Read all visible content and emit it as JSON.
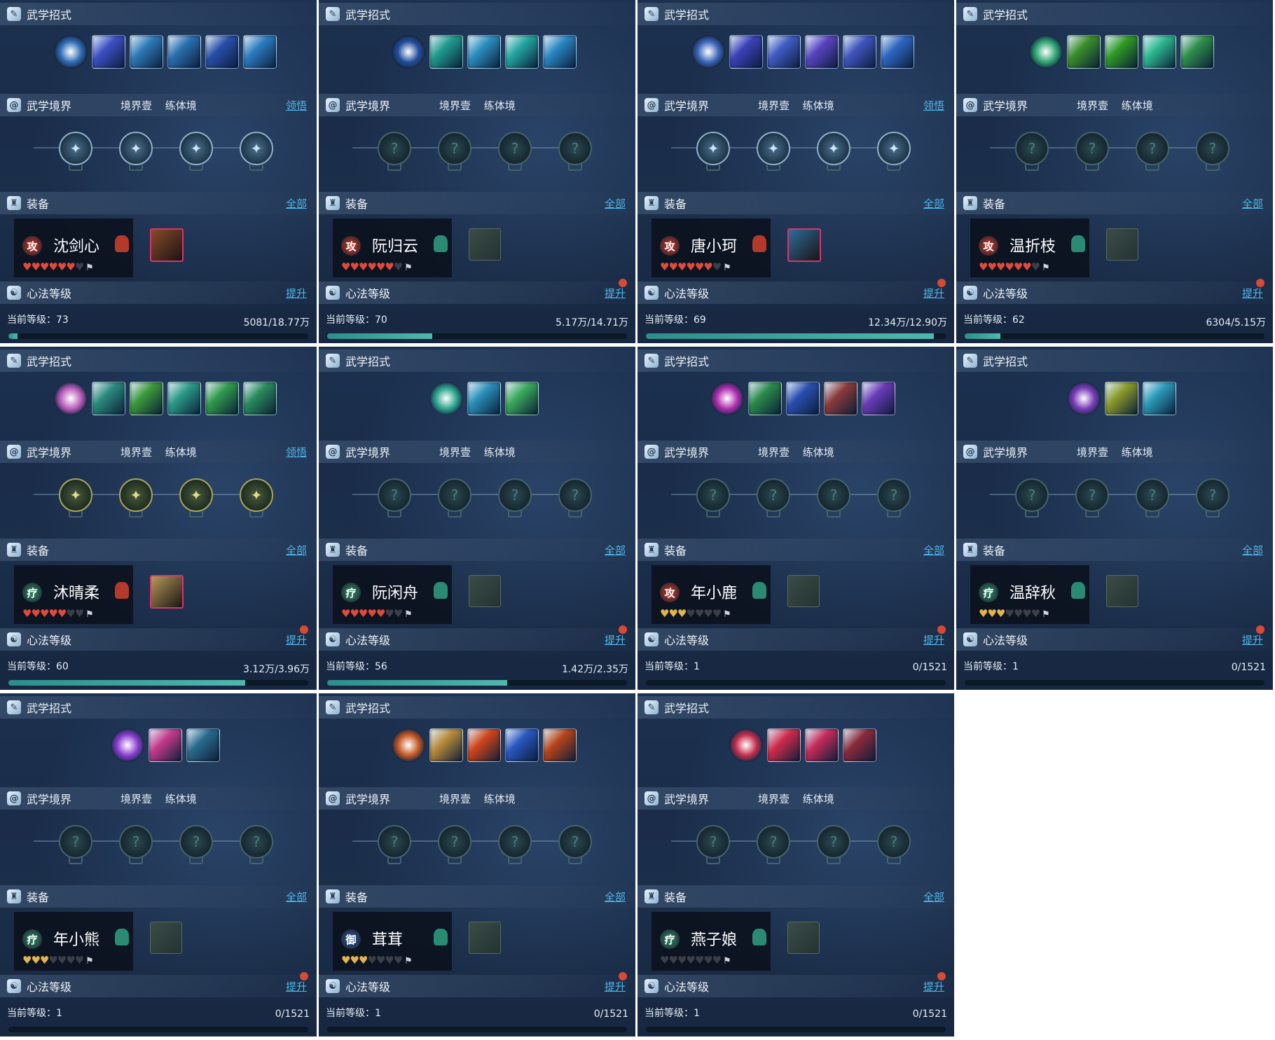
{
  "labels": {
    "skills_title": "武学招式",
    "realm_title": "武学境界",
    "realm_tag1": "境界壹",
    "realm_tag2": "练体境",
    "realm_action": "领悟",
    "equip_title": "装备",
    "equip_all": "全部",
    "mind_title": "心法等级",
    "mind_action": "提升",
    "level_prefix": "当前等级："
  },
  "panels": [
    {
      "name": "沈剑心",
      "badge": "攻",
      "badge_color": "#b2332b",
      "token_color": "#b33a2b",
      "hearts": {
        "full": 6,
        "gold": 0,
        "empty": 1,
        "type": "red"
      },
      "level": "73",
      "exp": "5081/18.77万",
      "progress": 0.03,
      "realm_action": true,
      "realm_lit": "lit",
      "notify": false,
      "equip": true,
      "equip_color": "#8a4a2a",
      "skill_colors": [
        "#2d6bb3",
        "#3d4fc4",
        "#2e7ab8",
        "#2a6fb0",
        "#284fa8",
        "#2a7cc0"
      ],
      "skill_count": 6
    },
    {
      "name": "阮归云",
      "badge": "攻",
      "badge_color": "#b2332b",
      "token_color": "#2a8a74",
      "hearts": {
        "full": 6,
        "gold": 0,
        "empty": 1,
        "type": "red"
      },
      "level": "70",
      "exp": "5.17万/14.71万",
      "progress": 0.35,
      "realm_action": false,
      "realm_lit": "none",
      "notify": true,
      "equip": false,
      "skill_colors": [
        "#1f4c9a",
        "#1f9a8c",
        "#2b8fbf",
        "#22a6a0",
        "#2a86c4"
      ],
      "skill_count": 5
    },
    {
      "name": "唐小珂",
      "badge": "攻",
      "badge_color": "#b2332b",
      "token_color": "#b33a2b",
      "hearts": {
        "full": 6,
        "gold": 0,
        "empty": 1,
        "type": "red"
      },
      "level": "69",
      "exp": "12.34万/12.90万",
      "progress": 0.96,
      "realm_action": true,
      "realm_lit": "lit",
      "notify": true,
      "equip": true,
      "equip_color": "#2d6c9a",
      "skill_colors": [
        "#3a64b8",
        "#3b40b8",
        "#3f5bc2",
        "#5a44c0",
        "#3f54bf",
        "#2d66c0"
      ],
      "skill_count": 6
    },
    {
      "name": "温折枝",
      "badge": "攻",
      "badge_color": "#b2332b",
      "token_color": "#2a8a74",
      "hearts": {
        "full": 6,
        "gold": 0,
        "empty": 1,
        "type": "red"
      },
      "level": "62",
      "exp": "6304/5.15万",
      "progress": 0.12,
      "realm_action": false,
      "realm_lit": "none",
      "notify": true,
      "equip": false,
      "skill_colors": [
        "#2aa36e",
        "#3a8f2a",
        "#2f9a25",
        "#2db88f",
        "#2e8f4a"
      ],
      "skill_count": 5
    },
    {
      "name": "沐晴柔",
      "badge": "疗",
      "badge_color": "#2a7a5e",
      "token_color": "#b33a2b",
      "hearts": {
        "full": 5,
        "gold": 0,
        "empty": 2,
        "type": "red"
      },
      "level": "60",
      "exp": "3.12万/3.96万",
      "progress": 0.79,
      "realm_action": true,
      "realm_lit": "gold",
      "notify": true,
      "equip": true,
      "equip_color": "#b89a5a",
      "skill_colors": [
        "#b85ab8",
        "#2a8a7c",
        "#3a9a3a",
        "#2a9a86",
        "#2f9a4a",
        "#2a8a5a"
      ],
      "skill_count": 6
    },
    {
      "name": "阮闲舟",
      "badge": "疗",
      "badge_color": "#2a7a5e",
      "token_color": "#2a8a74",
      "hearts": {
        "full": 5,
        "gold": 0,
        "empty": 2,
        "type": "red"
      },
      "level": "56",
      "exp": "1.42万/2.35万",
      "progress": 0.6,
      "realm_action": false,
      "realm_lit": "none",
      "notify": true,
      "equip": false,
      "skill_colors": [
        "#2aa38a",
        "#2a8fb8",
        "#3aa85a"
      ],
      "skill_count": 3
    },
    {
      "name": "年小鹿",
      "badge": "攻",
      "badge_color": "#b2332b",
      "token_color": "#2a8a74",
      "hearts": {
        "full": 0,
        "gold": 3,
        "empty": 4,
        "type": "gold"
      },
      "level": "1",
      "exp": "0/1521",
      "progress": 0.0,
      "realm_action": false,
      "realm_lit": "none",
      "notify": true,
      "equip": false,
      "skill_colors": [
        "#b02ab0",
        "#2a8a4a",
        "#2a4fb0",
        "#8a3a3a",
        "#6a3ab8"
      ],
      "skill_count": 5
    },
    {
      "name": "温辞秋",
      "badge": "疗",
      "badge_color": "#2a7a5e",
      "token_color": "#2a8a74",
      "hearts": {
        "full": 0,
        "gold": 3,
        "empty": 4,
        "type": "gold"
      },
      "level": "1",
      "exp": "0/1521",
      "progress": 0.0,
      "realm_action": false,
      "realm_lit": "none",
      "notify": true,
      "equip": false,
      "skill_colors": [
        "#7a3ab8",
        "#8a9a2a",
        "#2a9ab8"
      ],
      "skill_count": 3
    },
    {
      "name": "年小熊",
      "badge": "疗",
      "badge_color": "#2a7a5e",
      "token_color": "#2a8a74",
      "hearts": {
        "full": 0,
        "gold": 3,
        "empty": 4,
        "type": "gold"
      },
      "level": "1",
      "exp": "0/1521",
      "progress": 0.0,
      "realm_action": false,
      "realm_lit": "none",
      "notify": true,
      "equip": false,
      "skill_colors": [
        "#8a3ad0",
        "#c43a8a",
        "#2a6a8a"
      ],
      "skill_count": 3
    },
    {
      "name": "茸茸",
      "badge": "御",
      "badge_color": "#2a4f8a",
      "token_color": "#2a8a74",
      "hearts": {
        "full": 0,
        "gold": 3,
        "empty": 4,
        "type": "gold"
      },
      "level": "1",
      "exp": "0/1521",
      "progress": 0.0,
      "realm_action": false,
      "realm_lit": "none",
      "notify": true,
      "equip": false,
      "skill_colors": [
        "#c4541f",
        "#b88a3a",
        "#d0441a",
        "#2a56c0",
        "#b8441a"
      ],
      "skill_count": 5
    },
    {
      "name": "燕子娘",
      "badge": "疗",
      "badge_color": "#2a7a5e",
      "token_color": "#2a8a74",
      "hearts": {
        "full": 0,
        "gold": 0,
        "empty": 7,
        "type": "gold"
      },
      "level": "1",
      "exp": "0/1521",
      "progress": 0.0,
      "realm_action": false,
      "realm_lit": "none",
      "notify": true,
      "equip": false,
      "skill_colors": [
        "#c42a4a",
        "#d02a4a",
        "#c42a5a",
        "#8a2a3a"
      ],
      "skill_count": 4
    }
  ]
}
